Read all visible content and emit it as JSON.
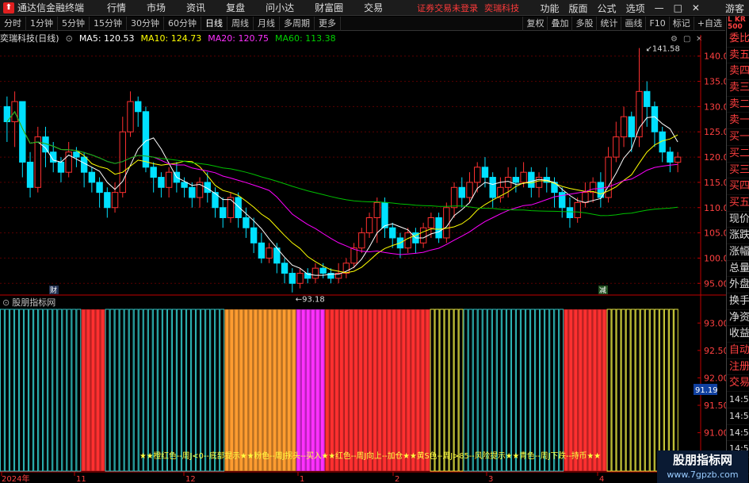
{
  "app": {
    "name": "通达信金融终端",
    "guest": "游客"
  },
  "menu": [
    "行情",
    "市场",
    "资讯",
    "复盘",
    "问小达",
    "财富圈",
    "交易"
  ],
  "trade_warning": "证券交易未登录",
  "stock_name_top": "奕瑞科技",
  "right_menu": [
    "功能",
    "版面",
    "公式",
    "选项"
  ],
  "periods": [
    "分时",
    "1分钟",
    "5分钟",
    "15分钟",
    "30分钟",
    "60分钟",
    "日线",
    "周线",
    "月线",
    "多周期",
    "更多"
  ],
  "active_period": "日线",
  "tools": [
    "复权",
    "叠加",
    "多股",
    "统计",
    "画线",
    "F10",
    "标记",
    "+自选"
  ],
  "ma": {
    "title": "奕瑞科技(日线)",
    "ma5": "MA5: 120.53",
    "ma10": "MA10: 124.73",
    "ma20": "MA20: 120.75",
    "ma60": "MA60: 113.38"
  },
  "indicator_title": "股朋指标网",
  "legend_text": "★★橙红色--周J<0--底部提示★★粉色--周J拐头--买入★★红色--周J向上--加仓★★黄S色--周J>85--风险提示★★青色--周J下跌--持币★★",
  "side": [
    "委比",
    "卖五",
    "卖四",
    "卖三",
    "卖二",
    "卖一",
    "买一",
    "买二",
    "买三",
    "买四",
    "买五",
    "现价",
    "涨跌",
    "涨幅",
    "总量",
    "外盘",
    "换手",
    "净资",
    "收益",
    "自动",
    "注册",
    "交易",
    "14:56",
    "14:56",
    "14:56",
    "14:56",
    "14:56",
    "14:56",
    "14:56"
  ],
  "lkr": "L KR 500",
  "watermark": {
    "title": "股朋指标网",
    "url": "www.7gpzb.com"
  },
  "markers": {
    "fin": "财",
    "cut": "减",
    "high": "141.58",
    "low": "93.18",
    "cursor_value": "91.19"
  },
  "date_labels": [
    "2024年",
    "11",
    "12",
    "1",
    "2",
    "3",
    "4"
  ],
  "colors": {
    "up": "#ff3030",
    "down": "#00e0ff",
    "ma5": "#ffffff",
    "ma10": "#ffff00",
    "ma20": "#ff00ff",
    "ma60": "#00c000",
    "indicator_orange": "#ff9c30",
    "indicator_pink": "#ff30ff",
    "indicator_yellow": "#e0e040",
    "indicator_cyan": "#30c0c0"
  },
  "chart_data": {
    "type": "candlestick",
    "price_axis": {
      "ticks": [
        95.0,
        100.0,
        105.0,
        110.0,
        115.0,
        120.0,
        125.0,
        130.0,
        135.0,
        140.0
      ],
      "range": [
        93.0,
        142.0
      ]
    },
    "indicator_axis": {
      "ticks": [
        90.5,
        91.0,
        91.5,
        92.0,
        92.5,
        93.0
      ]
    },
    "candles": [
      [
        130,
        127,
        132,
        123
      ],
      [
        127,
        131,
        133,
        122
      ],
      [
        131,
        119,
        131,
        116
      ],
      [
        119,
        114,
        121,
        112
      ],
      [
        114,
        124,
        126,
        113
      ],
      [
        124,
        121,
        126,
        118
      ],
      [
        121,
        119,
        123,
        117
      ],
      [
        119,
        117,
        120,
        115
      ],
      [
        117,
        121,
        123,
        116
      ],
      [
        121,
        120,
        122,
        118
      ],
      [
        120,
        117,
        121,
        114
      ],
      [
        117,
        115,
        118,
        113
      ],
      [
        115,
        113,
        116,
        110
      ],
      [
        113,
        110,
        114,
        108
      ],
      [
        110,
        113,
        115,
        109
      ],
      [
        113,
        125,
        128,
        112
      ],
      [
        125,
        131,
        133,
        124
      ],
      [
        131,
        129,
        132,
        126
      ],
      [
        129,
        118,
        130,
        117
      ],
      [
        118,
        116,
        119,
        113
      ],
      [
        116,
        114,
        117,
        112
      ],
      [
        114,
        117,
        118,
        112
      ],
      [
        117,
        115,
        119,
        113
      ],
      [
        115,
        114,
        116,
        112
      ],
      [
        114,
        112,
        115,
        110
      ],
      [
        112,
        115,
        116,
        110
      ],
      [
        115,
        113,
        117,
        111
      ],
      [
        113,
        110,
        114,
        108
      ],
      [
        110,
        108,
        112,
        106
      ],
      [
        108,
        112,
        113,
        107
      ],
      [
        112,
        108,
        113,
        106
      ],
      [
        108,
        106,
        110,
        104
      ],
      [
        106,
        103,
        108,
        101
      ],
      [
        103,
        100,
        105,
        99
      ],
      [
        100,
        102,
        103,
        99
      ],
      [
        102,
        99,
        103,
        97
      ],
      [
        99,
        97,
        100,
        95
      ],
      [
        97,
        95,
        98,
        93.2
      ],
      [
        95,
        97,
        98,
        94
      ],
      [
        97,
        96,
        98,
        95
      ],
      [
        96,
        98,
        99,
        95
      ],
      [
        98,
        97,
        99,
        96
      ],
      [
        97,
        96,
        98,
        95
      ],
      [
        96,
        97,
        99,
        95
      ],
      [
        97,
        99,
        100,
        96
      ],
      [
        99,
        102,
        103,
        98
      ],
      [
        102,
        105,
        106,
        101
      ],
      [
        105,
        108,
        109,
        104
      ],
      [
        108,
        111,
        112,
        103
      ],
      [
        111,
        106,
        112,
        104
      ],
      [
        106,
        104,
        107,
        102
      ],
      [
        104,
        102,
        105,
        100
      ],
      [
        102,
        105,
        106,
        101
      ],
      [
        105,
        103,
        106,
        101
      ],
      [
        103,
        106,
        107,
        102
      ],
      [
        106,
        108,
        109,
        104
      ],
      [
        108,
        104,
        109,
        103
      ],
      [
        104,
        110,
        111,
        103
      ],
      [
        110,
        114,
        115,
        108
      ],
      [
        114,
        112,
        116,
        110
      ],
      [
        112,
        115,
        117,
        111
      ],
      [
        115,
        118,
        119,
        113
      ],
      [
        118,
        116,
        120,
        114
      ],
      [
        116,
        112,
        117,
        110
      ],
      [
        112,
        114,
        116,
        111
      ],
      [
        114,
        116,
        118,
        112
      ],
      [
        116,
        115,
        118,
        113
      ],
      [
        115,
        117,
        119,
        114
      ],
      [
        117,
        114,
        118,
        112
      ],
      [
        114,
        116,
        117,
        112
      ],
      [
        116,
        115,
        118,
        113
      ],
      [
        115,
        113,
        116,
        110
      ],
      [
        113,
        110,
        114,
        108
      ],
      [
        110,
        108,
        112,
        106
      ],
      [
        108,
        111,
        112,
        107
      ],
      [
        111,
        113,
        115,
        110
      ],
      [
        113,
        115,
        116,
        111
      ],
      [
        115,
        112,
        117,
        110
      ],
      [
        112,
        120,
        122,
        111
      ],
      [
        120,
        124,
        127,
        119
      ],
      [
        124,
        128,
        130,
        122
      ],
      [
        128,
        124,
        129,
        121
      ],
      [
        124,
        133,
        141.58,
        122
      ],
      [
        133,
        130,
        135,
        126
      ],
      [
        130,
        125,
        131,
        122
      ],
      [
        125,
        121,
        126,
        119
      ],
      [
        121,
        119,
        122,
        117
      ],
      [
        119,
        120,
        121,
        117
      ]
    ],
    "indicator_bands": [
      {
        "color": "cyan",
        "from": 0,
        "to": 17
      },
      {
        "color": "red",
        "from": 17,
        "to": 22
      },
      {
        "color": "cyan",
        "from": 22,
        "to": 47
      },
      {
        "color": "orange",
        "from": 47,
        "to": 62
      },
      {
        "color": "pink",
        "from": 62,
        "to": 68
      },
      {
        "color": "red",
        "from": 68,
        "to": 90
      },
      {
        "color": "yellow",
        "from": 90,
        "to": 97
      },
      {
        "color": "cyan",
        "from": 97,
        "to": 118
      },
      {
        "color": "red",
        "from": 118,
        "to": 127
      },
      {
        "color": "yellow",
        "from": 127,
        "to": 142
      }
    ]
  }
}
